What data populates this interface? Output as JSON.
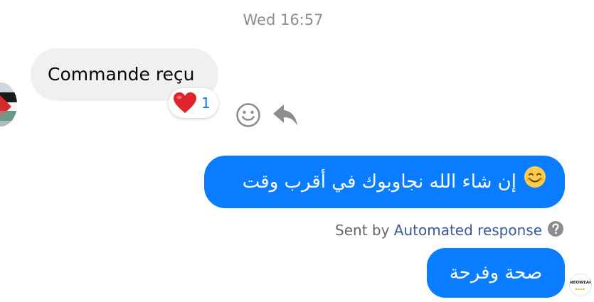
{
  "conversation": {
    "timestamp": "Wed 16:57",
    "incoming_message": {
      "text": "Commande reçu",
      "reaction": {
        "emoji": "heart",
        "count": "1"
      }
    },
    "outgoing_messages": [
      {
        "text": "إن شاء الله نجاوبوك في أقرب وقت",
        "emoji": "smiling-face-icon"
      },
      {
        "text": "صحة وفرحة"
      }
    ],
    "sent_by": {
      "prefix": "Sent by",
      "sender": "Automated response"
    },
    "brand_avatar": {
      "logo_text": "NEOWEAR"
    }
  },
  "colors": {
    "outgoing_bubble": "#0a7cff",
    "incoming_bubble": "#f0f0f0",
    "timestamp": "#8a8d91",
    "reaction_count": "#0a7cff"
  }
}
